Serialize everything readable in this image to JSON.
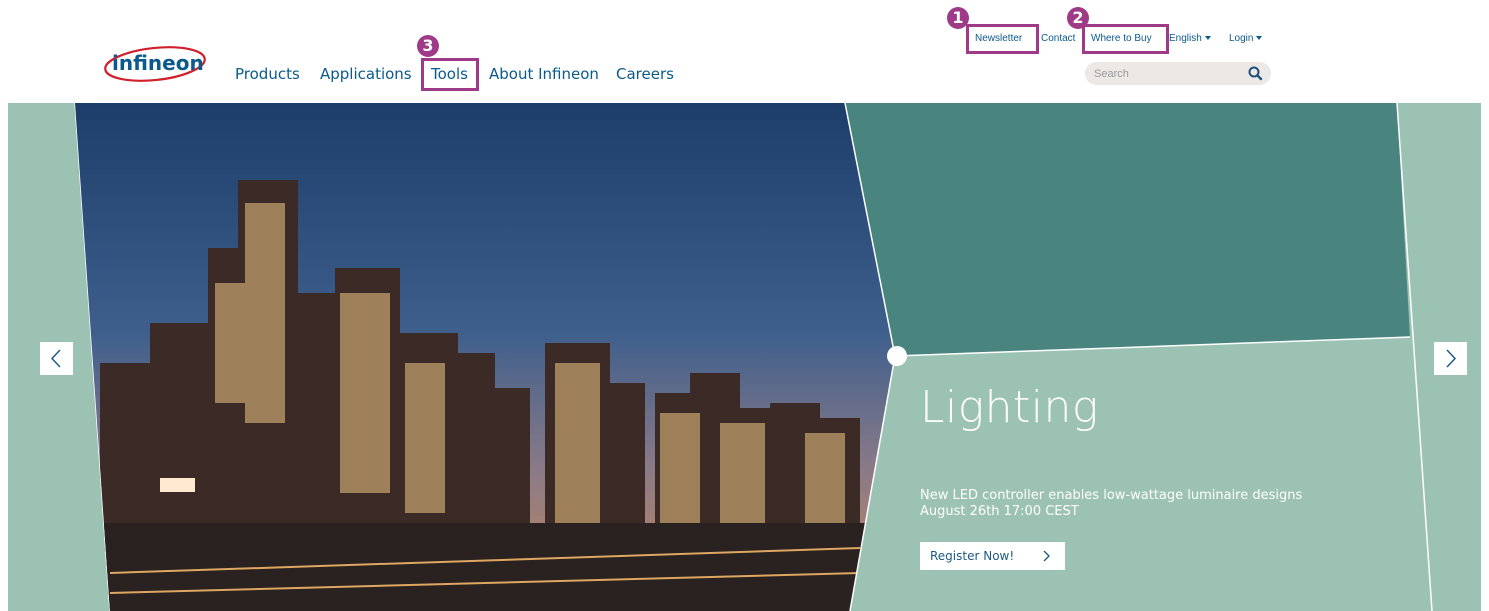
{
  "brand": {
    "logo_text": "infineon"
  },
  "main_nav": [
    {
      "label": "Products"
    },
    {
      "label": "Applications"
    },
    {
      "label": "Tools"
    },
    {
      "label": "About Infineon"
    },
    {
      "label": "Careers"
    }
  ],
  "util_nav": {
    "newsletter": "Newsletter",
    "contact": "Contact",
    "where_to_buy": "Where to Buy",
    "language": "English",
    "login": "Login"
  },
  "search": {
    "placeholder": "Search"
  },
  "annotations": {
    "badge_1": "1",
    "badge_2": "2",
    "badge_3": "3"
  },
  "slide": {
    "title": "Lighting",
    "line1": "New LED controller enables low-wattage luminaire designs",
    "line2": "August 26th 17:00 CEST",
    "button": "Register Now!"
  },
  "colors": {
    "accent_highlight": "#9e3a87",
    "link_blue": "#0b5a8c",
    "teal_dark": "#4a847f",
    "teal_light": "#9cc2b4"
  },
  "icons": {
    "search": "search-icon",
    "prev": "chevron-left-icon",
    "next": "chevron-right-icon",
    "caret": "caret-down-icon"
  }
}
